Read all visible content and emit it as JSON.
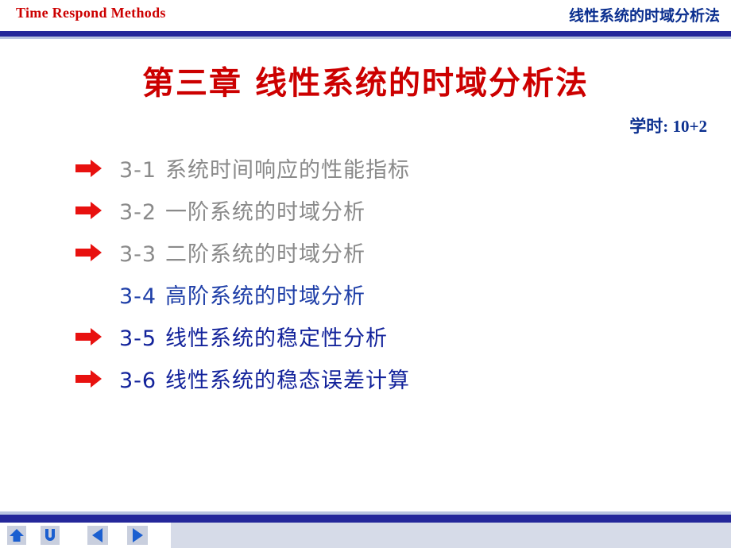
{
  "header": {
    "left_title": "Time Respond Methods",
    "right_title": "线性系统的时域分析法",
    "rule_color": "#24279a"
  },
  "slide": {
    "title": "第三章  线性系统的时域分析法",
    "title_color": "#cc0000",
    "hours_label": "学时: 10+2",
    "hours_color": "#0b2f8f"
  },
  "outline": {
    "items": [
      {
        "number": "3-1",
        "label": "系统时间响应的性能指标",
        "arrow": true,
        "color": "#8a8a8a"
      },
      {
        "number": "3-2",
        "label": "一阶系统的时域分析",
        "arrow": true,
        "color": "#8a8a8a"
      },
      {
        "number": "3-3",
        "label": "二阶系统的时域分析",
        "arrow": true,
        "color": "#8a8a8a"
      },
      {
        "number": "3-4",
        "label": "高阶系统的时域分析",
        "arrow": false,
        "color": "#1f3fa8"
      },
      {
        "number": "3-5",
        "label": "线性系统的稳定性分析",
        "arrow": true,
        "color": "#13239b"
      },
      {
        "number": "3-6",
        "label": "线性系统的稳态误差计算",
        "arrow": true,
        "color": "#13239b"
      }
    ],
    "arrow_color": "#e8110f"
  },
  "footer": {
    "band_color": "#d6dbe8",
    "buttons": [
      {
        "name": "home",
        "glyph": "▲",
        "color": "#1b5fd0"
      },
      {
        "name": "up",
        "glyph": "U",
        "color": "#1b5fd0"
      },
      {
        "name": "prev",
        "glyph": "◀",
        "color": "#1b5fd0"
      },
      {
        "name": "next",
        "glyph": "▶",
        "color": "#1b5fd0"
      }
    ]
  }
}
